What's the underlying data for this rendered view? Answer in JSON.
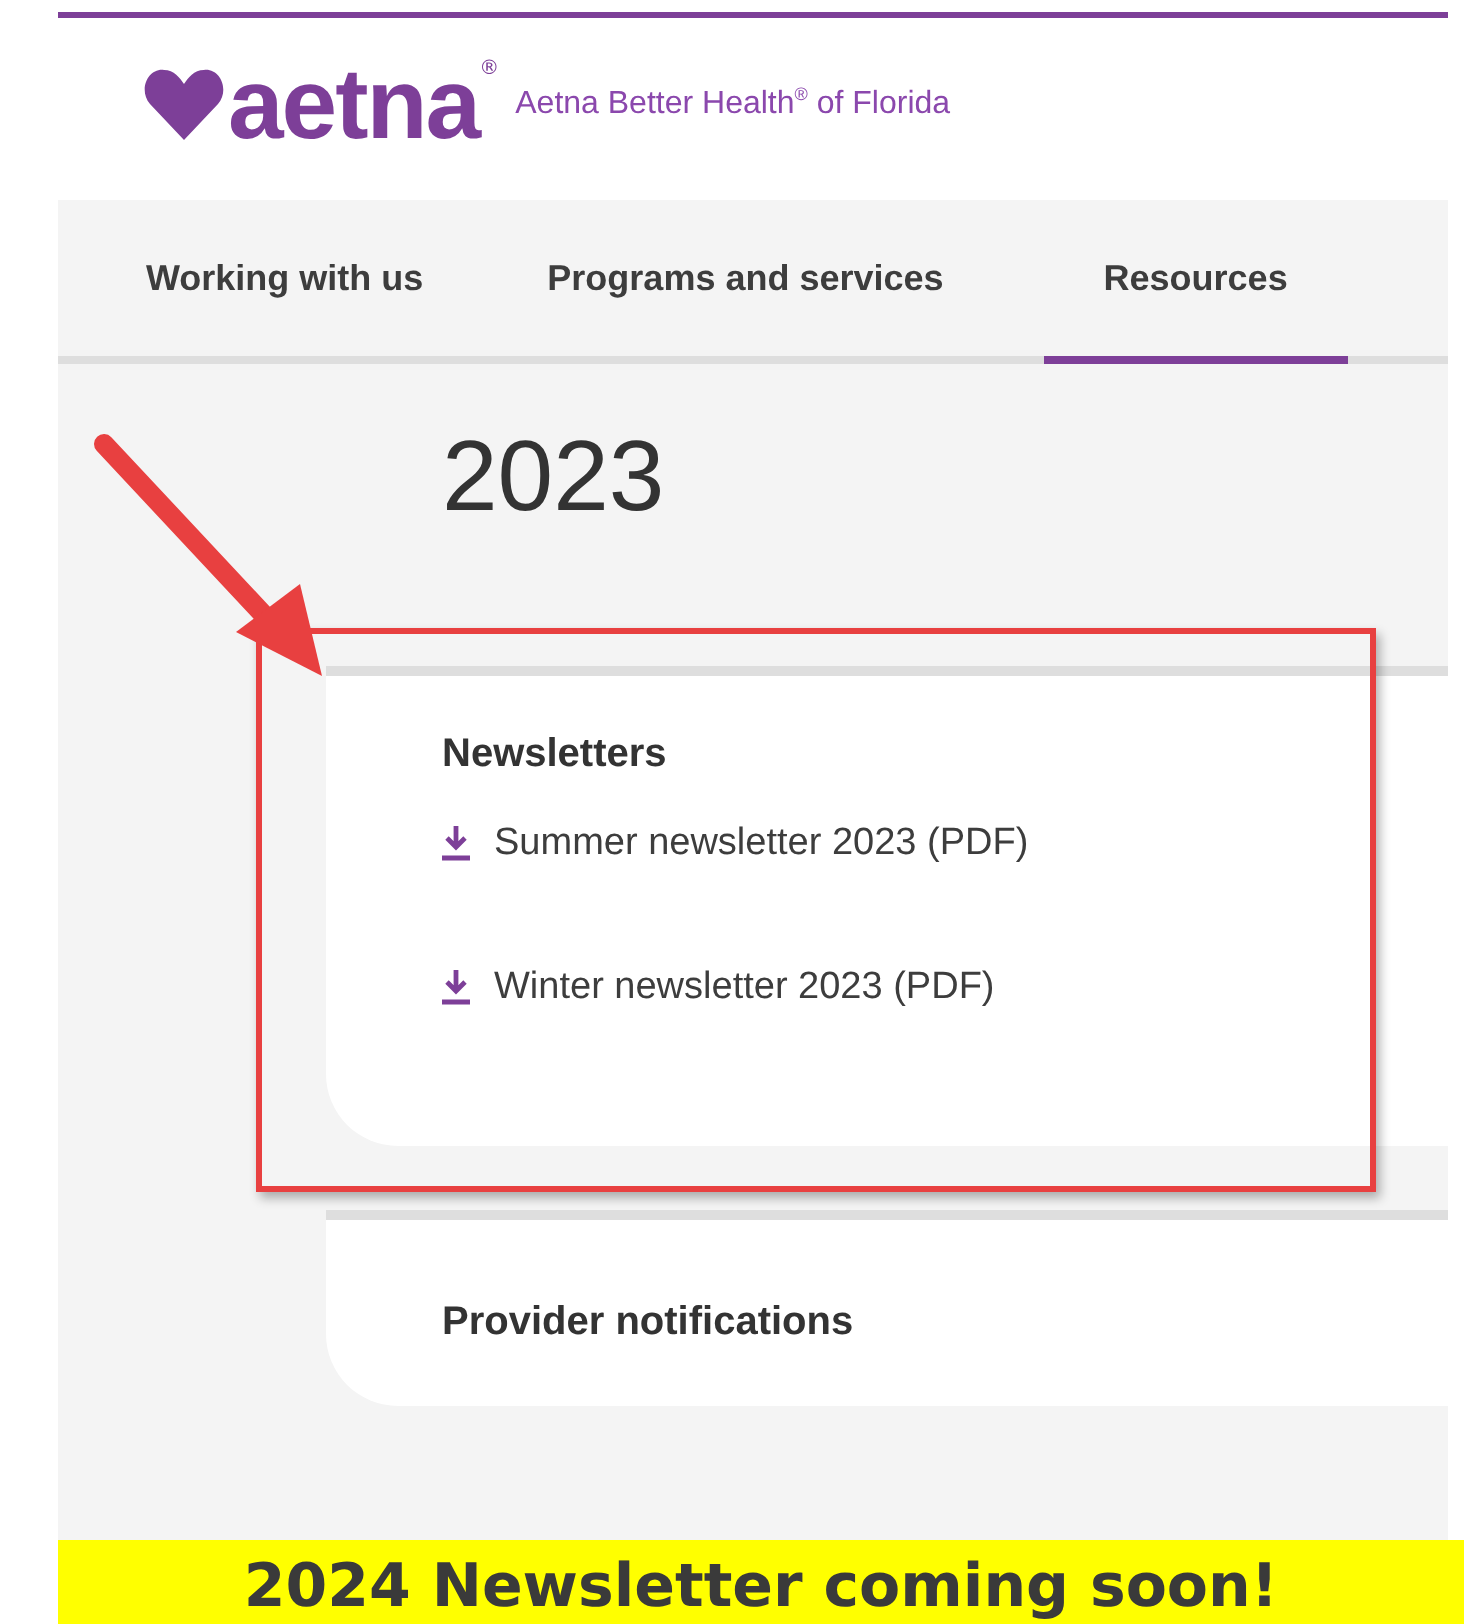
{
  "brand": {
    "logo_text": "aetna",
    "logo_mark": "®",
    "tagline": "Aetna Better Health$^{®}$ of Florida"
  },
  "nav": {
    "tabs": [
      {
        "label": "Working with us",
        "selected": false
      },
      {
        "label": "Programs and services",
        "selected": false
      },
      {
        "label": "Resources",
        "selected": true
      }
    ]
  },
  "year_heading": "2023",
  "sections": [
    {
      "title": "Newsletters",
      "highlighted": true,
      "links": [
        "Summer newsletter 2023 (PDF)",
        "Winter newsletter 2023 (PDF)"
      ]
    },
    {
      "title": "Provider notifications",
      "highlighted": false
    }
  ],
  "banner": "2024 Newsletter coming soon!"
}
